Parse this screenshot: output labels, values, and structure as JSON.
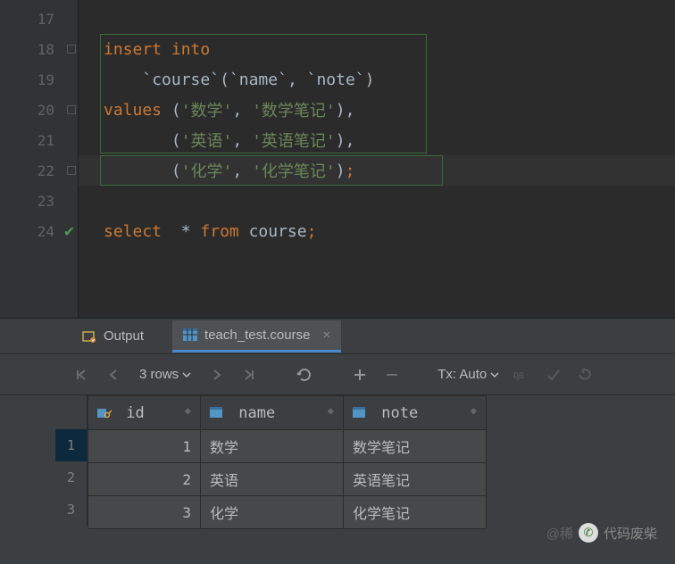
{
  "editor": {
    "lines": [
      {
        "num": "17",
        "tokens": []
      },
      {
        "num": "18",
        "fold": true,
        "tokens": [
          {
            "t": "insert ",
            "c": "kw"
          },
          {
            "t": "into",
            "c": "kw"
          }
        ]
      },
      {
        "num": "19",
        "tokens": [
          {
            "t": "    ",
            "c": "pun"
          },
          {
            "t": "`course`",
            "c": "bt"
          },
          {
            "t": "(",
            "c": "pun"
          },
          {
            "t": "`name`",
            "c": "bt"
          },
          {
            "t": ", ",
            "c": "pun"
          },
          {
            "t": "`note`",
            "c": "bt"
          },
          {
            "t": ")",
            "c": "pun"
          }
        ]
      },
      {
        "num": "20",
        "fold": true,
        "tokens": [
          {
            "t": "values ",
            "c": "kw"
          },
          {
            "t": "(",
            "c": "pun"
          },
          {
            "t": "'数学'",
            "c": "str"
          },
          {
            "t": ", ",
            "c": "pun"
          },
          {
            "t": "'数学笔记'",
            "c": "str"
          },
          {
            "t": "),",
            "c": "pun"
          }
        ]
      },
      {
        "num": "21",
        "tokens": [
          {
            "t": "       (",
            "c": "pun"
          },
          {
            "t": "'英语'",
            "c": "str"
          },
          {
            "t": ", ",
            "c": "pun"
          },
          {
            "t": "'英语笔记'",
            "c": "str"
          },
          {
            "t": "),",
            "c": "pun"
          }
        ]
      },
      {
        "num": "22",
        "fold": true,
        "current": true,
        "tokens": [
          {
            "t": "       (",
            "c": "pun"
          },
          {
            "t": "'化学'",
            "c": "str"
          },
          {
            "t": ", ",
            "c": "pun"
          },
          {
            "t": "'化学笔记'",
            "c": "str"
          },
          {
            "t": ")",
            "c": "pun"
          },
          {
            "t": ";",
            "c": "kw"
          }
        ]
      },
      {
        "num": "23",
        "tokens": []
      },
      {
        "num": "24",
        "check": true,
        "tokens": [
          {
            "t": "select  ",
            "c": "kw"
          },
          {
            "t": "* ",
            "c": "star"
          },
          {
            "t": "from ",
            "c": "kw"
          },
          {
            "t": "course",
            "c": "id"
          },
          {
            "t": ";",
            "c": "kw"
          }
        ]
      }
    ]
  },
  "tabs": {
    "output": "Output",
    "table": "teach_test.course"
  },
  "toolbar": {
    "rows": "3 rows",
    "tx": "Tx: Auto"
  },
  "table": {
    "columns": [
      "id",
      "name",
      "note"
    ],
    "rows": [
      {
        "n": "1",
        "id": "1",
        "name": "数学",
        "note": "数学笔记"
      },
      {
        "n": "2",
        "id": "2",
        "name": "英语",
        "note": "英语笔记"
      },
      {
        "n": "3",
        "id": "3",
        "name": "化学",
        "note": "化学笔记"
      }
    ]
  },
  "watermark": {
    "text": "代码废柴",
    "pre": "@稀"
  }
}
